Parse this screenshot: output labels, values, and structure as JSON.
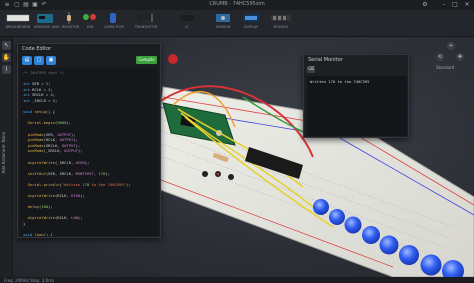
{
  "app": {
    "title": "CRUMB - 74HC595sim"
  },
  "toolbar": {
    "tools": [
      {
        "label": "BREADBOARD",
        "icon": "breadboard-icon"
      },
      {
        "label": "ARDUINO UNO",
        "icon": "arduino-icon"
      },
      {
        "label": "RESISTOR",
        "icon": "resistor-icon"
      },
      {
        "label": "LED",
        "icon": "led-icon"
      },
      {
        "label": "CAPACITOR",
        "icon": "capacitor-icon"
      },
      {
        "label": "TRANSISTOR",
        "icon": "transistor-icon"
      },
      {
        "label": "IC",
        "icon": "ic-icon"
      },
      {
        "label": "SENSOR",
        "icon": "sensor-icon"
      },
      {
        "label": "DISPLAY",
        "icon": "display-icon"
      },
      {
        "label": "MODULE",
        "icon": "module-icon"
      }
    ]
  },
  "leftrail": {
    "vertical_label": "Add Arduino® Nano"
  },
  "nav": {
    "view_label": "Standard"
  },
  "editor": {
    "title": "Code Editor",
    "compile_label": "Compile",
    "lines": [
      "/* 74HC595 test */",
      "",
      "int SER = 2;",
      "int RCLK = 3;",
      "int SRCLK = 4;",
      "int _SRCLR = 5;",
      "",
      "void setup() {",
      "",
      "  Serial.begin(9600);",
      "",
      "  pinMode(SER, OUTPUT);",
      "  pinMode(RCLK, OUTPUT);",
      "  pinMode(SRCLK, OUTPUT);",
      "  pinMode(_SRCLR, OUTPUT);",
      "",
      "  digitalWrite(_SRCLR, HIGH);",
      "",
      "  shiftOut(SER, SRCLK, MSBFIRST, 170);",
      "",
      "  Serial.println(\"Written 170 to the 74HC595\");",
      "",
      "  digitalWrite(RCLK, HIGH);",
      "",
      "  delay(100);",
      "",
      "  digitalWrite(RCLK, LOW);",
      "}",
      "",
      "void loop() {",
      "",
      "}"
    ]
  },
  "serial": {
    "title": "Serial Monitor",
    "output": "Written 170 to the 74HC595"
  },
  "status": {
    "text": "Freq: 20MHz  Step: 3.0ms"
  },
  "colors": {
    "accent": "#2d82d6",
    "compile": "#3aa03a",
    "led_blue": "#2f5cf0",
    "arduino_green": "#1f6b3c"
  }
}
